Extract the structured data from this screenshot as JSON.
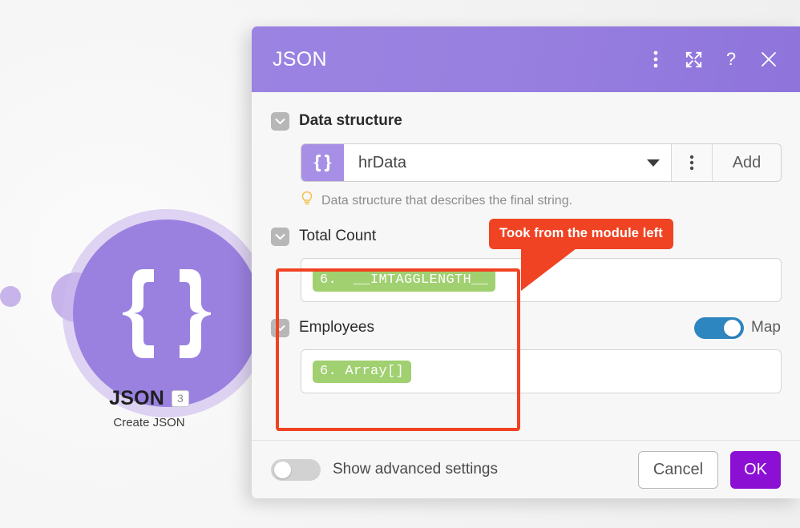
{
  "canvas": {
    "module": {
      "title": "JSON",
      "badge": "3",
      "subtitle": "Create JSON",
      "icon": "json-braces-icon",
      "circle_color": "#9a81e0",
      "halo_color": "#cdbbee"
    }
  },
  "dialog": {
    "title": "JSON",
    "header_color_start": "#9b83e2",
    "header_color_end": "#8e74db",
    "header_icons": [
      {
        "name": "kebab-menu-icon",
        "glyph": "⋮"
      },
      {
        "name": "expand-icon",
        "glyph": "⤡"
      },
      {
        "name": "help-icon",
        "glyph": "?"
      },
      {
        "name": "close-icon",
        "glyph": "×"
      }
    ],
    "fields": [
      {
        "label": "Data structure",
        "bold": true,
        "select_value": "hrData",
        "prefix_icon": "json-braces-icon",
        "kebab_label": "⋮",
        "add_label": "Add",
        "hint": "Data structure that describes the final string.",
        "hint_icon": "lightbulb-icon"
      },
      {
        "label": "Total Count",
        "bold": false,
        "token": "6.  __IMTAGGLENGTH__"
      },
      {
        "label": "Employees",
        "bold": false,
        "toggle_label": "Map",
        "toggle_on": true,
        "toggle_color": "#2e86c1",
        "token": "6. Array[]"
      }
    ],
    "footer": {
      "advanced_label": "Show advanced settings",
      "advanced_toggle_on": false,
      "cancel_label": "Cancel",
      "ok_label": "OK",
      "ok_color": "#8c10d4"
    }
  },
  "annotations": {
    "callout_text": "Took from the module left",
    "color": "#f04323"
  }
}
